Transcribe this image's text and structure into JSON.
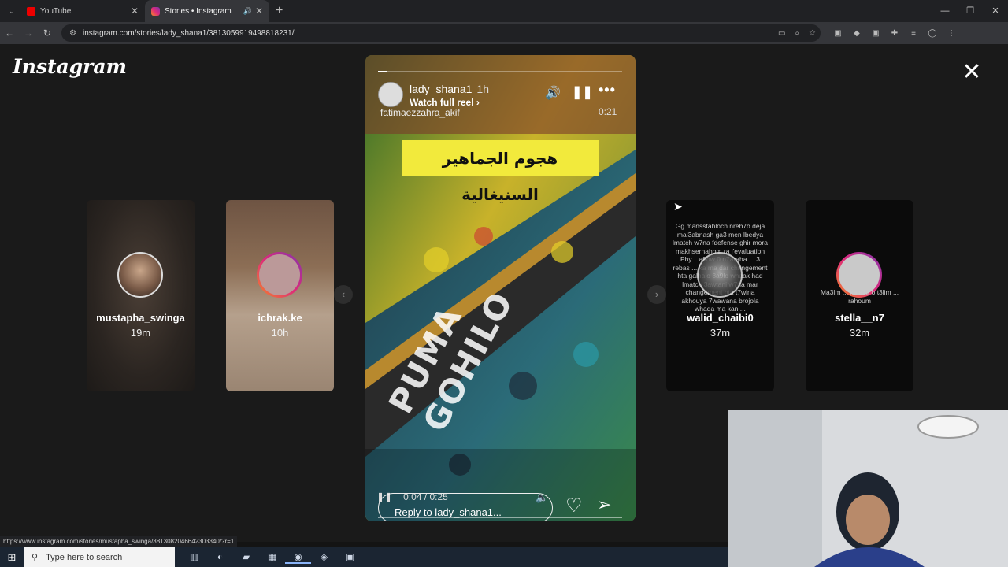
{
  "browser": {
    "tabs": [
      {
        "title": "YouTube",
        "active": false
      },
      {
        "title": "Stories • Instagram",
        "active": true
      }
    ],
    "new_tab": "+",
    "url": "instagram.com/stories/lady_shana1/3813059919498818231/",
    "status_url": "https://www.instagram.com/stories/mustapha_swinga/3813082046642303340/?r=1"
  },
  "instagram": {
    "logo": "Instagram",
    "close": "✕",
    "story": {
      "username": "lady_shana1",
      "age": "1h",
      "watch_full_reel": "Watch full reel ›",
      "tagged_user": "fatimaezzahra_akif",
      "duration": "0:21",
      "caption_arabic": "هجوم الجماهير السنيغالية",
      "banner_text": "PUMA GOHILO",
      "player_time": "0:04 / 0:25",
      "reply_placeholder": "Reply to lady_shana1...",
      "progress": 0.04
    },
    "side_stories": [
      {
        "name": "mustapha_swinga",
        "time": "19m"
      },
      {
        "name": "ichrak.ke",
        "time": "10h"
      },
      {
        "name": "walid_chaibi0",
        "time": "37m",
        "overlay_text": "Gg mansstahloch nreb7o deja mal3abnash ga3 men lbedya lmatch w7na fdefense ghir mora makhsernahom ra l'evaluation Phy... a9ow 0 n7araha ... 3 rebas ... ka ma dar changement hta galhalo 3a9lo wnaak had lmatch 3awtani w7na mar changement hta t7wina akhouya 7wawana brojola whada ma kan ..."
      },
      {
        "name": "stella__n7",
        "time": "32m",
        "overlay_text": "Ma3lm ... ka s7a o t3lim ... rahoum"
      }
    ]
  },
  "taskbar": {
    "search_placeholder": "Type here to search"
  }
}
